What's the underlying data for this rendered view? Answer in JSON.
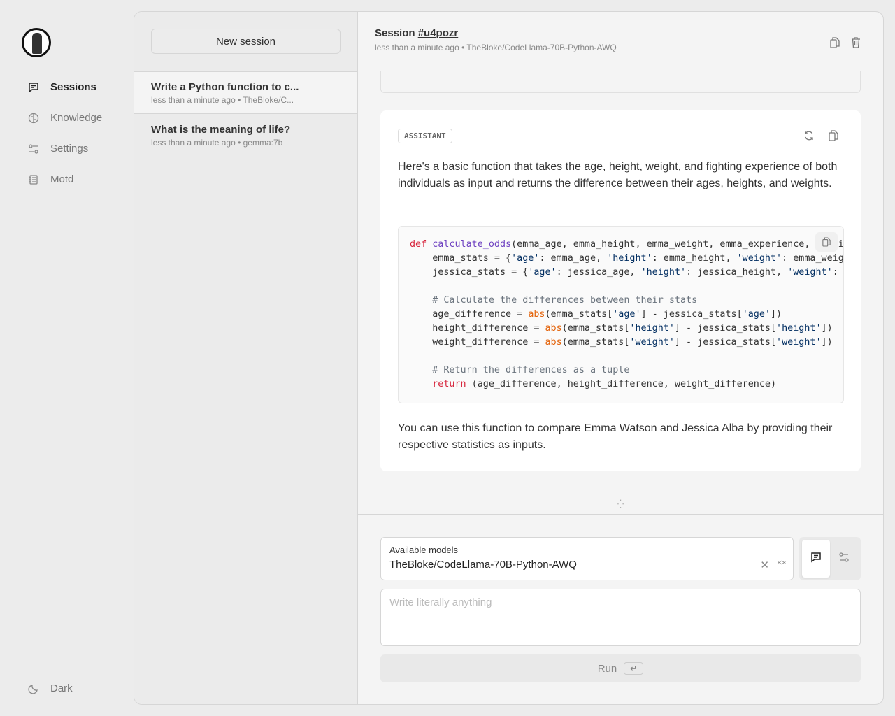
{
  "sidebar": {
    "items": [
      {
        "label": "Sessions",
        "icon": "chat-icon",
        "active": true
      },
      {
        "label": "Knowledge",
        "icon": "brain-icon"
      },
      {
        "label": "Settings",
        "icon": "sliders-icon"
      },
      {
        "label": "Motd",
        "icon": "notebook-icon"
      }
    ],
    "theme_toggle": "Dark"
  },
  "sessions": {
    "new_label": "New session",
    "items": [
      {
        "title": "Write a Python function to c...",
        "meta": "less than a minute ago • TheBloke/C..."
      },
      {
        "title": "What is the meaning of life?",
        "meta": "less than a minute ago • gemma:7b"
      }
    ]
  },
  "header": {
    "prefix": "Session",
    "id": "#u4pozr",
    "meta": "less than a minute ago • TheBloke/CodeLlama-70B-Python-AWQ"
  },
  "message": {
    "role": "ASSISTANT",
    "intro": "Here's a basic function that takes the age, height, weight, and fighting experience of both individuals as input and returns the difference between their ages, heights, and weights.",
    "code": [
      [
        [
          "k",
          "def "
        ],
        [
          "f",
          "calculate_odds"
        ],
        [
          "",
          "(emma_age, emma_height, emma_weight, emma_experience, jessica_age, jessica_height, jessica_weight, jessica_experience):"
        ]
      ],
      [
        [
          "",
          "    emma_stats = {"
        ],
        [
          "s",
          "'age'"
        ],
        [
          "",
          ": emma_age, "
        ],
        [
          "s",
          "'height'"
        ],
        [
          "",
          ": emma_height, "
        ],
        [
          "s",
          "'weight'"
        ],
        [
          "",
          ": emma_weight}"
        ]
      ],
      [
        [
          "",
          "    jessica_stats = {"
        ],
        [
          "s",
          "'age'"
        ],
        [
          "",
          ": jessica_age, "
        ],
        [
          "s",
          "'height'"
        ],
        [
          "",
          ": jessica_height, "
        ],
        [
          "s",
          "'weight'"
        ],
        [
          "",
          ": jessica_weight}"
        ]
      ],
      [],
      [
        [
          "c",
          "    # Calculate the differences between their stats"
        ]
      ],
      [
        [
          "",
          "    age_difference = "
        ],
        [
          "b",
          "abs"
        ],
        [
          "",
          "(emma_stats["
        ],
        [
          "s",
          "'age'"
        ],
        [
          "",
          "] - jessica_stats["
        ],
        [
          "s",
          "'age'"
        ],
        [
          "",
          "])"
        ]
      ],
      [
        [
          "",
          "    height_difference = "
        ],
        [
          "b",
          "abs"
        ],
        [
          "",
          "(emma_stats["
        ],
        [
          "s",
          "'height'"
        ],
        [
          "",
          "] - jessica_stats["
        ],
        [
          "s",
          "'height'"
        ],
        [
          "",
          "])"
        ]
      ],
      [
        [
          "",
          "    weight_difference = "
        ],
        [
          "b",
          "abs"
        ],
        [
          "",
          "(emma_stats["
        ],
        [
          "s",
          "'weight'"
        ],
        [
          "",
          "] - jessica_stats["
        ],
        [
          "s",
          "'weight'"
        ],
        [
          "",
          "])"
        ]
      ],
      [],
      [
        [
          "c",
          "    # Return the differences as a tuple"
        ]
      ],
      [
        [
          "k",
          "    return"
        ],
        [
          "",
          " (age_difference, height_difference, weight_difference)"
        ]
      ]
    ],
    "outro": "You can use this function to compare Emma Watson and Jessica Alba by providing their respective statistics as inputs."
  },
  "composer": {
    "model_label": "Available models",
    "model_value": "TheBloke/CodeLlama-70B-Python-AWQ",
    "placeholder": "Write literally anything",
    "run_label": "Run",
    "run_key": "↵"
  }
}
